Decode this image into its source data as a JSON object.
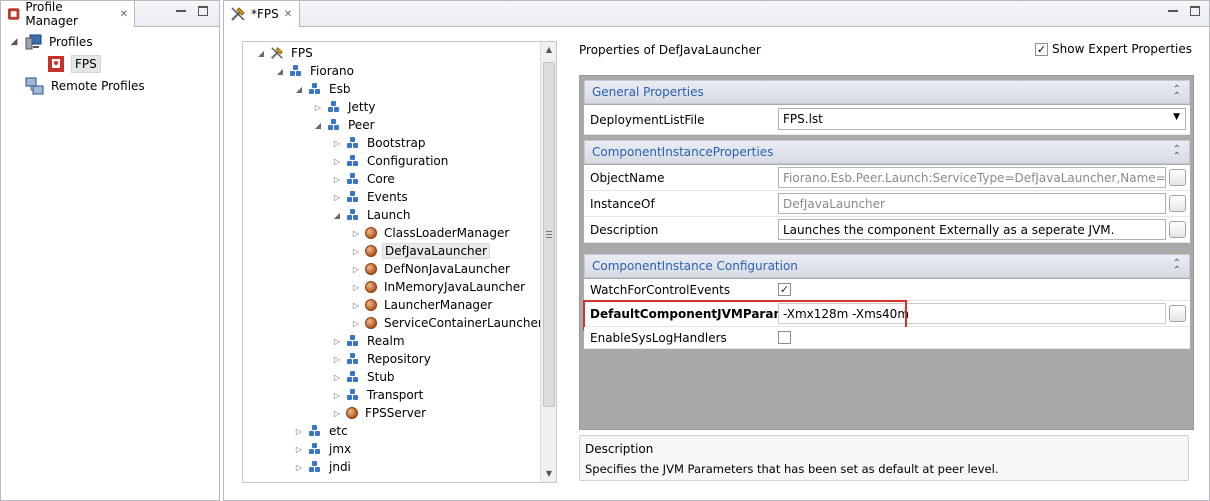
{
  "left_pane": {
    "tab_title": "Profile Manager",
    "tree": [
      {
        "label": "Profiles",
        "expanded": true
      },
      {
        "label": "FPS",
        "selected": true
      },
      {
        "label": "Remote Profiles"
      }
    ]
  },
  "editor": {
    "tab_title": "*FPS",
    "tree": [
      {
        "label": "FPS",
        "level": 0,
        "toggle": "expanded",
        "icon": "wrench-icon"
      },
      {
        "label": "Fiorano",
        "level": 1,
        "toggle": "expanded",
        "icon": "package-icon"
      },
      {
        "label": "Esb",
        "level": 2,
        "toggle": "expanded",
        "icon": "package-icon"
      },
      {
        "label": "Jetty",
        "level": 3,
        "toggle": "collapsed",
        "icon": "package-icon"
      },
      {
        "label": "Peer",
        "level": 3,
        "toggle": "expanded",
        "icon": "package-icon"
      },
      {
        "label": "Bootstrap",
        "level": 4,
        "toggle": "collapsed",
        "icon": "package-icon"
      },
      {
        "label": "Configuration",
        "level": 4,
        "toggle": "collapsed",
        "icon": "package-icon"
      },
      {
        "label": "Core",
        "level": 4,
        "toggle": "collapsed",
        "icon": "package-icon"
      },
      {
        "label": "Events",
        "level": 4,
        "toggle": "collapsed",
        "icon": "package-icon"
      },
      {
        "label": "Launch",
        "level": 4,
        "toggle": "expanded",
        "icon": "package-icon"
      },
      {
        "label": "ClassLoaderManager",
        "level": 5,
        "toggle": "collapsed",
        "icon": "bean-icon"
      },
      {
        "label": "DefJavaLauncher",
        "level": 5,
        "toggle": "collapsed",
        "icon": "bean-icon",
        "selected": true
      },
      {
        "label": "DefNonJavaLauncher",
        "level": 5,
        "toggle": "collapsed",
        "icon": "bean-icon"
      },
      {
        "label": "InMemoryJavaLauncher",
        "level": 5,
        "toggle": "collapsed",
        "icon": "bean-icon"
      },
      {
        "label": "LauncherManager",
        "level": 5,
        "toggle": "collapsed",
        "icon": "bean-icon"
      },
      {
        "label": "ServiceContainerLauncher",
        "level": 5,
        "toggle": "collapsed",
        "icon": "bean-icon"
      },
      {
        "label": "Realm",
        "level": 4,
        "toggle": "collapsed",
        "icon": "package-icon"
      },
      {
        "label": "Repository",
        "level": 4,
        "toggle": "collapsed",
        "icon": "package-icon"
      },
      {
        "label": "Stub",
        "level": 4,
        "toggle": "collapsed",
        "icon": "package-icon"
      },
      {
        "label": "Transport",
        "level": 4,
        "toggle": "collapsed",
        "icon": "package-icon"
      },
      {
        "label": "FPSServer",
        "level": 4,
        "toggle": "collapsed",
        "icon": "bean-icon"
      },
      {
        "label": "etc",
        "level": 2,
        "toggle": "collapsed",
        "icon": "package-icon"
      },
      {
        "label": "jmx",
        "level": 2,
        "toggle": "collapsed",
        "icon": "package-icon"
      },
      {
        "label": "jndi",
        "level": 2,
        "toggle": "collapsed",
        "icon": "package-icon"
      }
    ]
  },
  "properties": {
    "title": "Properties of DefJavaLauncher",
    "expert_label": "Show Expert Properties",
    "expert_checked": true,
    "sections": [
      {
        "title": "General Properties",
        "rows": [
          {
            "name": "DeploymentListFile",
            "value": "FPS.lst",
            "kind": "dropdown"
          }
        ]
      },
      {
        "title": "ComponentInstanceProperties",
        "rows": [
          {
            "name": "ObjectName",
            "value": "Fiorano.Esb.Peer.Launch:ServiceType=DefJavaLauncher,Name=DefJavaLauncher",
            "kind": "readonly"
          },
          {
            "name": "InstanceOf",
            "value": "DefJavaLauncher",
            "kind": "readonly"
          },
          {
            "name": "Description",
            "value": "Launches the component Externally as a seperate JVM.",
            "kind": "text"
          }
        ]
      },
      {
        "title": "ComponentInstance Configuration",
        "rows": [
          {
            "name": "WatchForControlEvents",
            "kind": "checkbox",
            "checked": true
          },
          {
            "name": "DefaultComponentJVMParams",
            "value": "-Xmx128m -Xms40m",
            "kind": "text",
            "highlighted": true
          },
          {
            "name": "EnableSysLogHandlers",
            "kind": "checkbox",
            "checked": false
          }
        ]
      }
    ],
    "description_box": {
      "title": "Description",
      "text": "Specifies the JVM Parameters that has been set as default at peer level."
    }
  },
  "colors": {
    "section_title": "#2d5fb3",
    "highlight_border": "#d9302c"
  }
}
